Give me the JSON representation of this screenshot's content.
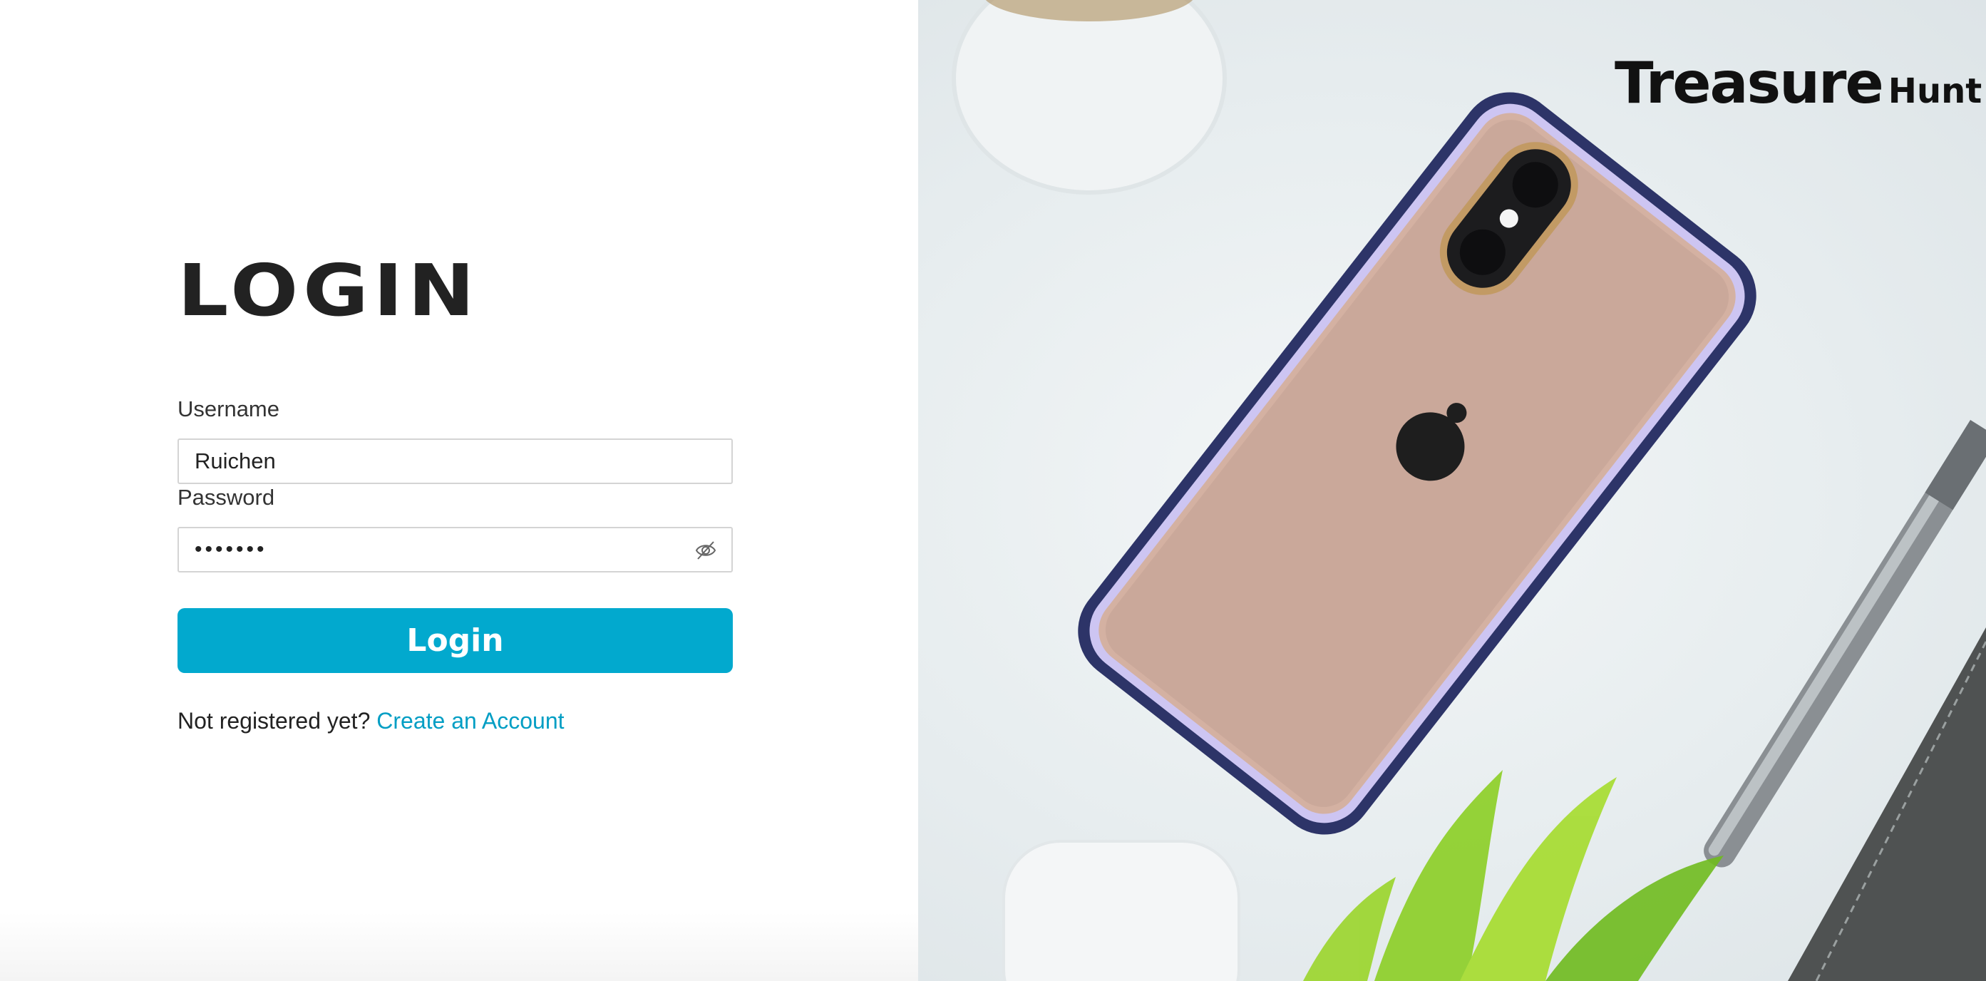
{
  "login": {
    "heading": "LOGIN",
    "username_label": "Username",
    "username_value": "Ruichen",
    "password_label": "Password",
    "password_value": "•••••••",
    "button_label": "Login",
    "register_prompt": "Not registered yet?",
    "register_link": "Create an Account"
  },
  "brand": {
    "main": "Treasure",
    "sub": "Hunt"
  },
  "icons": {
    "password_toggle": "eye-slash-icon"
  },
  "colors": {
    "accent": "#02a9ce",
    "link": "#029ec4",
    "heading": "#222222"
  }
}
